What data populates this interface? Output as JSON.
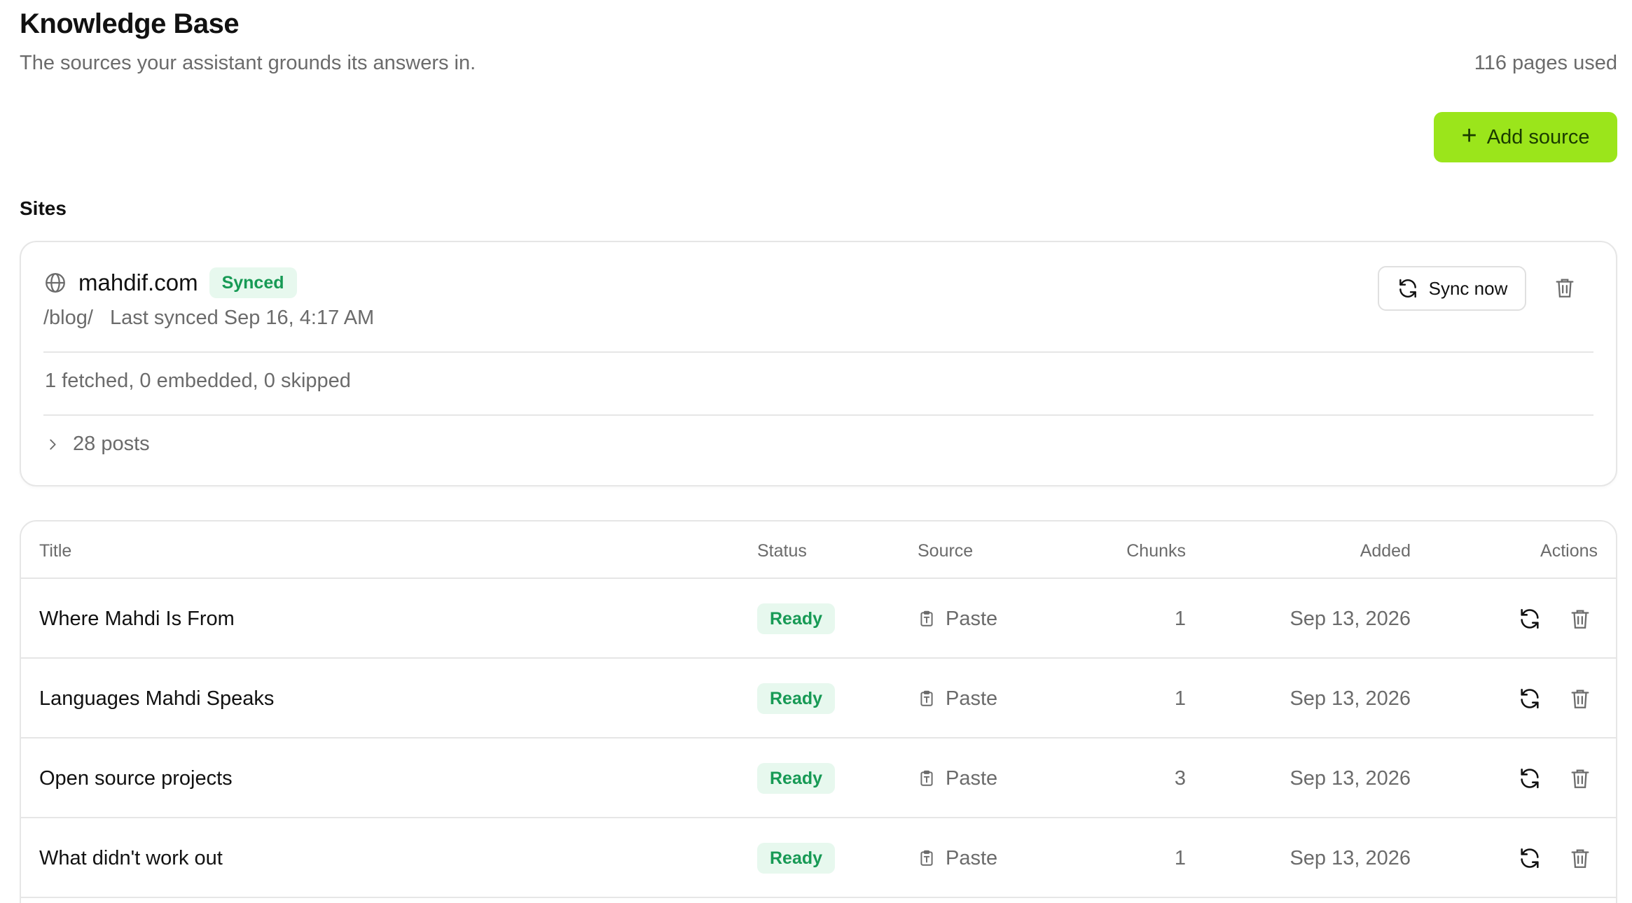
{
  "header": {
    "title": "Knowledge Base",
    "subtitle": "The sources your assistant grounds its answers in.",
    "usage": "116 pages used",
    "add_button": "Add source"
  },
  "sites": {
    "section_label": "Sites",
    "site": {
      "name": "mahdif.com",
      "status": "Synced",
      "path": "/blog/",
      "last_synced": "Last synced Sep 16, 4:17 AM",
      "sync_button": "Sync now",
      "stats": "1 fetched, 0 embedded, 0 skipped",
      "posts_toggle": "28 posts"
    }
  },
  "table": {
    "columns": {
      "title": "Title",
      "status": "Status",
      "source": "Source",
      "chunks": "Chunks",
      "added": "Added",
      "actions": "Actions"
    },
    "rows": [
      {
        "title": "Where Mahdi Is From",
        "status": "Ready",
        "source": "Paste",
        "chunks": "1",
        "added": "Sep 13, 2026"
      },
      {
        "title": "Languages Mahdi Speaks",
        "status": "Ready",
        "source": "Paste",
        "chunks": "1",
        "added": "Sep 13, 2026"
      },
      {
        "title": "Open source projects",
        "status": "Ready",
        "source": "Paste",
        "chunks": "3",
        "added": "Sep 13, 2026"
      },
      {
        "title": "What didn't work out",
        "status": "Ready",
        "source": "Paste",
        "chunks": "1",
        "added": "Sep 13, 2026"
      }
    ]
  },
  "colors": {
    "accent": "#9be51b",
    "success_bg": "#e7f8ee",
    "success_text": "#179a55"
  }
}
